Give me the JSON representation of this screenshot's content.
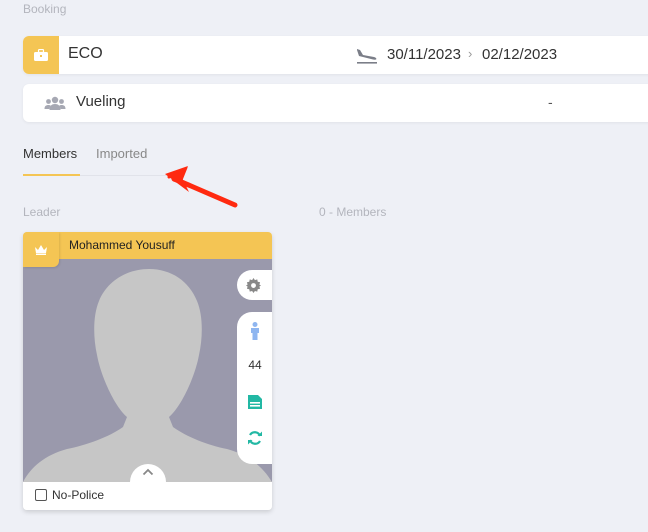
{
  "booking": {
    "section_label": "Booking",
    "class_label": "ECO",
    "date_from": "30/11/2023",
    "date_separator": "›",
    "date_to": "02/12/2023",
    "airline": "Vueling",
    "airline_value": "-"
  },
  "tabs": [
    {
      "label": "Members",
      "active": true
    },
    {
      "label": "Imported",
      "active": false
    }
  ],
  "leader_label": "Leader",
  "members_count_label": "0 - Members",
  "member_card": {
    "name": "Mohammed Yousuff",
    "age": "44",
    "checkbox_label": "No-Police",
    "checkbox_checked": false
  },
  "colors": {
    "accent": "#f4c554",
    "background": "#eef0f6",
    "photo_bg": "#9a99ac",
    "annotation_arrow": "#ff2a10",
    "person_icon": "#8fb6f0",
    "passport_icon": "#22b8a4"
  },
  "icons": {
    "class_badge": "briefcase-icon",
    "flight": "plane-landing-icon",
    "passengers": "users-group-icon",
    "leader": "crown-icon",
    "settings": "gear-icon",
    "person": "person-icon",
    "document": "passport-icon",
    "sync": "refresh-icon",
    "expand": "chevron-up-icon"
  }
}
